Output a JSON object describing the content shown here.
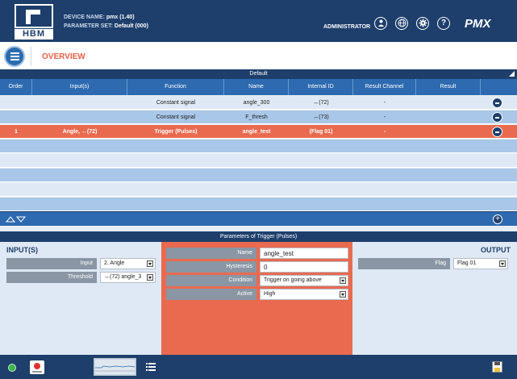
{
  "header": {
    "device_name_label": "DEVICE NAME:",
    "device_name_value": "pmx  (1.40)",
    "parameter_set_label": "PARAMETER SET:",
    "parameter_set_value": "Default (000)",
    "user": "ADMINISTRATOR",
    "logo_text": "HBM",
    "brand": "PMX",
    "icons": [
      "user-icon",
      "globe-icon",
      "settings-icon",
      "help-icon"
    ]
  },
  "overview": {
    "title": "OVERVIEW"
  },
  "table": {
    "group": "Default",
    "columns": [
      "Order",
      "Input(s)",
      "Function",
      "Name",
      "Internal ID",
      "Result Channel",
      "Result"
    ],
    "rows": [
      [
        "",
        "",
        "Constant signal",
        "angle_300",
        "↔(72)",
        "-",
        ""
      ],
      [
        "",
        "",
        "Constant signal",
        "F_thresh",
        "↔(73)",
        "-",
        ""
      ],
      [
        "1",
        "Angle, ↔(72)",
        "Trigger (Pulses)",
        "angle_test",
        "(Flag 01)",
        "-",
        ""
      ]
    ]
  },
  "params": {
    "title": "Parameters of Trigger (Pulses)",
    "inputs_title": "INPUT(S)",
    "output_title": "OUTPUT",
    "inputs": [
      {
        "label": "Input",
        "value": "2. Angle"
      },
      {
        "label": "Threshold",
        "value": "↔(72) angle_3"
      }
    ],
    "middle": [
      {
        "label": "Name",
        "value": "angle_test"
      },
      {
        "label": "Hysteresis",
        "value": "0"
      },
      {
        "label": "Condition",
        "value": "Trigger on going above"
      },
      {
        "label": "Active",
        "value": "High"
      }
    ],
    "output": [
      {
        "label": "Flag",
        "value": "Flag 01"
      }
    ]
  },
  "colors": {
    "header": "#1e3f6c",
    "accent": "#ea6a4f",
    "table_header": "#2d6ab0"
  }
}
